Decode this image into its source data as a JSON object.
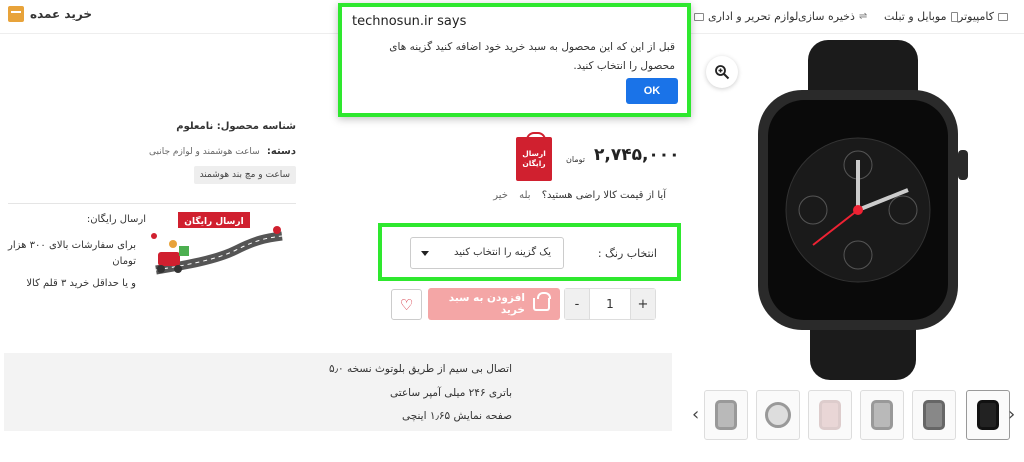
{
  "nav": {
    "items": [
      {
        "label": "کامپیوتر"
      },
      {
        "label": "موبایل و تبلت"
      },
      {
        "label": "ذخیره سازی"
      },
      {
        "label": "لوازم تحریر و اداری"
      }
    ],
    "bulk_label": "خرید عمده"
  },
  "dialog": {
    "title": "technosun.ir says",
    "message": "قبل از این که این محصول به سبد خرید خود اضافه کنید گزینه های محصول را انتخاب کنید.",
    "ok_label": "OK"
  },
  "product": {
    "price": "۲,۷۴۵,۰۰۰",
    "currency": "تومان",
    "free_shipping_badge": "ارسال رایگان",
    "satisfaction_question": "آیا از قیمت کالا راضی هستید؟",
    "yes": "بله",
    "no": "خیر",
    "color_label": "انتخاب رنگ :",
    "color_placeholder": "یک گزینه را انتخاب کنید",
    "quantity": "1",
    "add_to_cart": "افزودن به سبد خرید",
    "sku_label": "شناسه محصول: نامعلوم",
    "category_label": "دسته:",
    "category_value": "ساعت هوشمند و لوازم جانبی",
    "tag": "ساعت و مچ بند هوشمند",
    "shipping_title": "ارسال رایگان:",
    "shipping_text": "برای سفارشات بالای ۳۰۰ هزار تومان",
    "shipping_text2": "و یا حداقل خرید ۳ قلم کالا",
    "shipping_art_label": "ارسال رایگان",
    "features": [
      "اتصال بی سیم از طریق بلوتوث نسخه ۵٫۰",
      "باتری ۲۴۶ میلی آمپر ساعتی",
      "صفحه نمایش ۱٫۶۵ اینچی"
    ]
  },
  "colors": {
    "accent": "#d0202f",
    "highlight": "#2ee82e",
    "ok_button": "#1a73e8",
    "add_to_cart": "#f4a6a6"
  }
}
